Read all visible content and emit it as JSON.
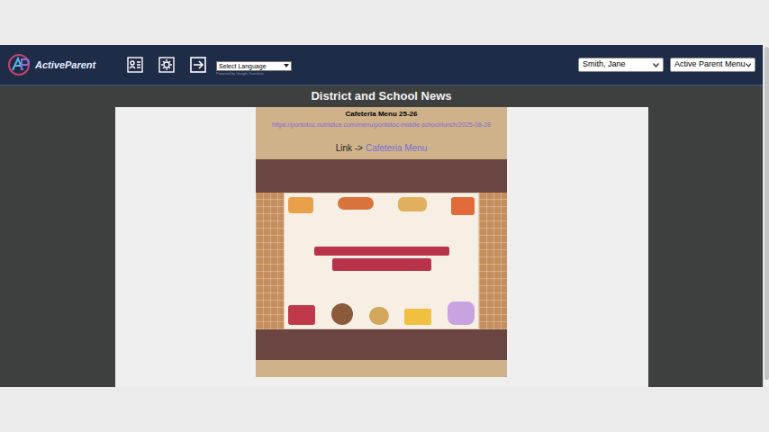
{
  "nav": {
    "logo": "ActiveParent",
    "language_select": "Select Language",
    "powered_by": "Powered by Google Translate",
    "user_select": "Smith, Jane",
    "menu_select": "Active Parent Menu"
  },
  "page": {
    "heading": "District and School News"
  },
  "post": {
    "title": "Cafeteria Menu 25-26",
    "url": "https://pontotoc.nutrislice.com/menu/pontotoc-middle-school/lunch/2025-08-28",
    "link_prefix": "Link ->",
    "link_text": "Cafeteria Menu"
  }
}
